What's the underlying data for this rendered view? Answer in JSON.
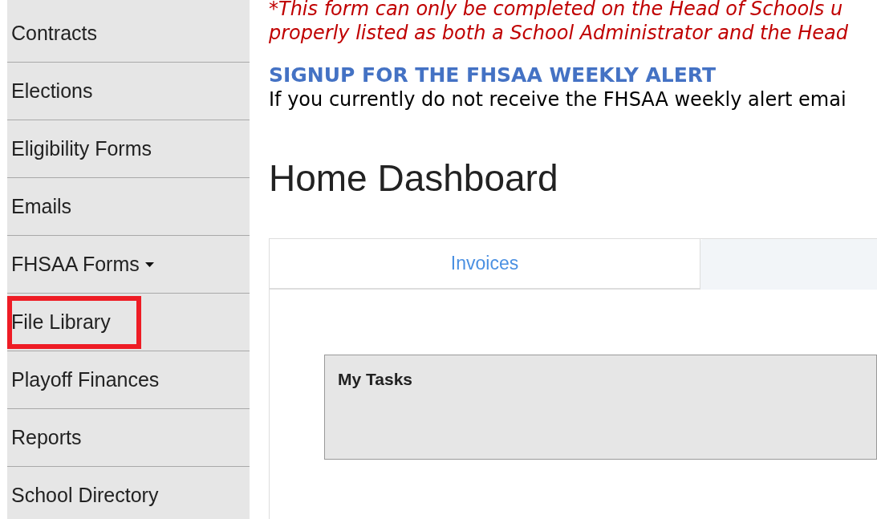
{
  "sidebar": {
    "items": [
      {
        "label": "Contracts",
        "dropdown": false,
        "highlighted": false
      },
      {
        "label": "Elections",
        "dropdown": false,
        "highlighted": false
      },
      {
        "label": "Eligibility Forms",
        "dropdown": false,
        "highlighted": false
      },
      {
        "label": "Emails",
        "dropdown": false,
        "highlighted": false
      },
      {
        "label": "FHSAA Forms",
        "dropdown": true,
        "highlighted": false
      },
      {
        "label": "File Library",
        "dropdown": false,
        "highlighted": true
      },
      {
        "label": "Playoff Finances",
        "dropdown": false,
        "highlighted": false
      },
      {
        "label": "Reports",
        "dropdown": false,
        "highlighted": false
      },
      {
        "label": "School Directory",
        "dropdown": false,
        "highlighted": false
      }
    ]
  },
  "notice": {
    "lines": [
      "*This form can only be completed on the Head of Schools u",
      "properly listed as both a School Administrator and the Head"
    ]
  },
  "signup": {
    "heading": "SIGNUP FOR THE FHSAA WEEKLY ALERT",
    "text": "If you currently do not receive the FHSAA weekly alert emai"
  },
  "page_title": "Home Dashboard",
  "tabs": [
    {
      "label": "Invoices",
      "selected": true
    },
    {
      "selected": false
    }
  ],
  "tasks_panel": {
    "title": "My Tasks"
  }
}
